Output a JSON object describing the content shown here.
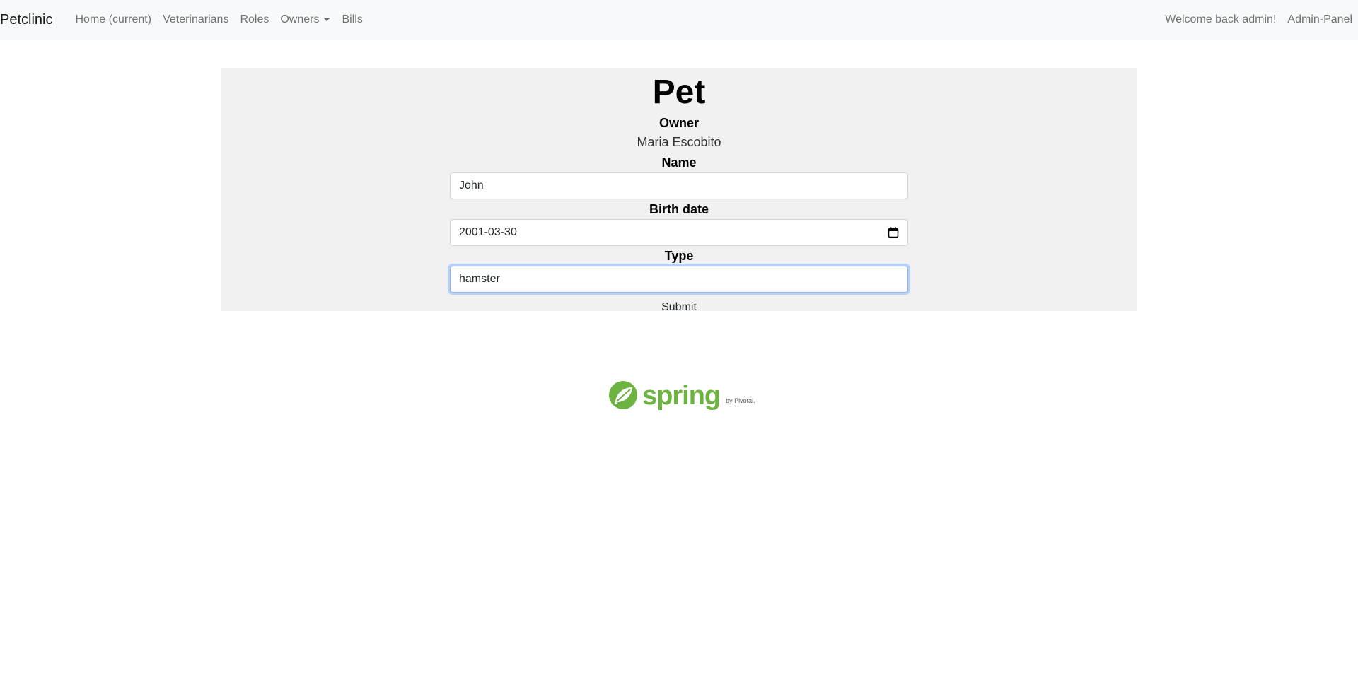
{
  "navbar": {
    "brand": "Petclinic",
    "links": {
      "home": "Home (current)",
      "vets": "Veterinarians",
      "roles": "Roles",
      "owners": "Owners",
      "bills": "Bills"
    },
    "right": {
      "welcome": "Welcome back admin!",
      "admin": "Admin-Panel"
    }
  },
  "form": {
    "title": "Pet",
    "owner_label": "Owner",
    "owner_value": "Maria Escobito",
    "name_label": "Name",
    "name_value": "John",
    "birth_label": "Birth date",
    "birth_value": "2001-03-30",
    "type_label": "Type",
    "type_value": "hamster",
    "submit_label": "Submit"
  },
  "footer": {
    "logo_text": "spring",
    "logo_sub": "by Pivotal."
  },
  "colors": {
    "navbar_bg": "#f8f9fa",
    "panel_bg": "#f1f1f1",
    "focus_ring": "#86b7fe",
    "spring_green": "#6db33f"
  },
  "icons": {
    "calendar": "calendar-icon",
    "leaf": "spring-leaf-icon",
    "dropdown": "caret-down-icon"
  }
}
